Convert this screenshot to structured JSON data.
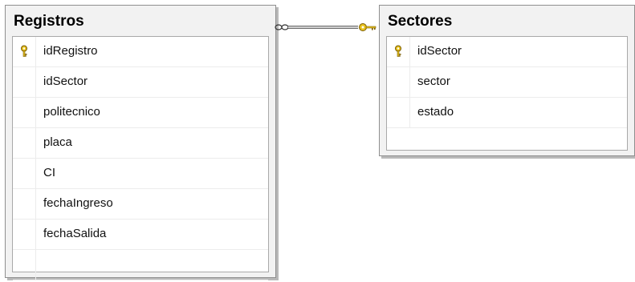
{
  "diagram": {
    "tables": [
      {
        "name": "Registros",
        "columns": [
          {
            "label": "idRegistro",
            "primary_key": true
          },
          {
            "label": "idSector",
            "primary_key": false
          },
          {
            "label": "politecnico",
            "primary_key": false
          },
          {
            "label": "placa",
            "primary_key": false
          },
          {
            "label": "CI",
            "primary_key": false
          },
          {
            "label": "fechaIngreso",
            "primary_key": false
          },
          {
            "label": "fechaSalida",
            "primary_key": false
          }
        ]
      },
      {
        "name": "Sectores",
        "columns": [
          {
            "label": "idSector",
            "primary_key": true
          },
          {
            "label": "sector",
            "primary_key": false
          },
          {
            "label": "estado",
            "primary_key": false
          }
        ]
      }
    ],
    "relationship": {
      "from_table": "Registros",
      "to_table": "Sectores",
      "from_end": "many-infinity-icon",
      "to_end": "one-key-icon"
    },
    "colors": {
      "key_gold": "#e8c21f",
      "key_outline": "#7a5c00",
      "line": "#6e6e6e",
      "table_bg": "#f2f2f2"
    }
  }
}
